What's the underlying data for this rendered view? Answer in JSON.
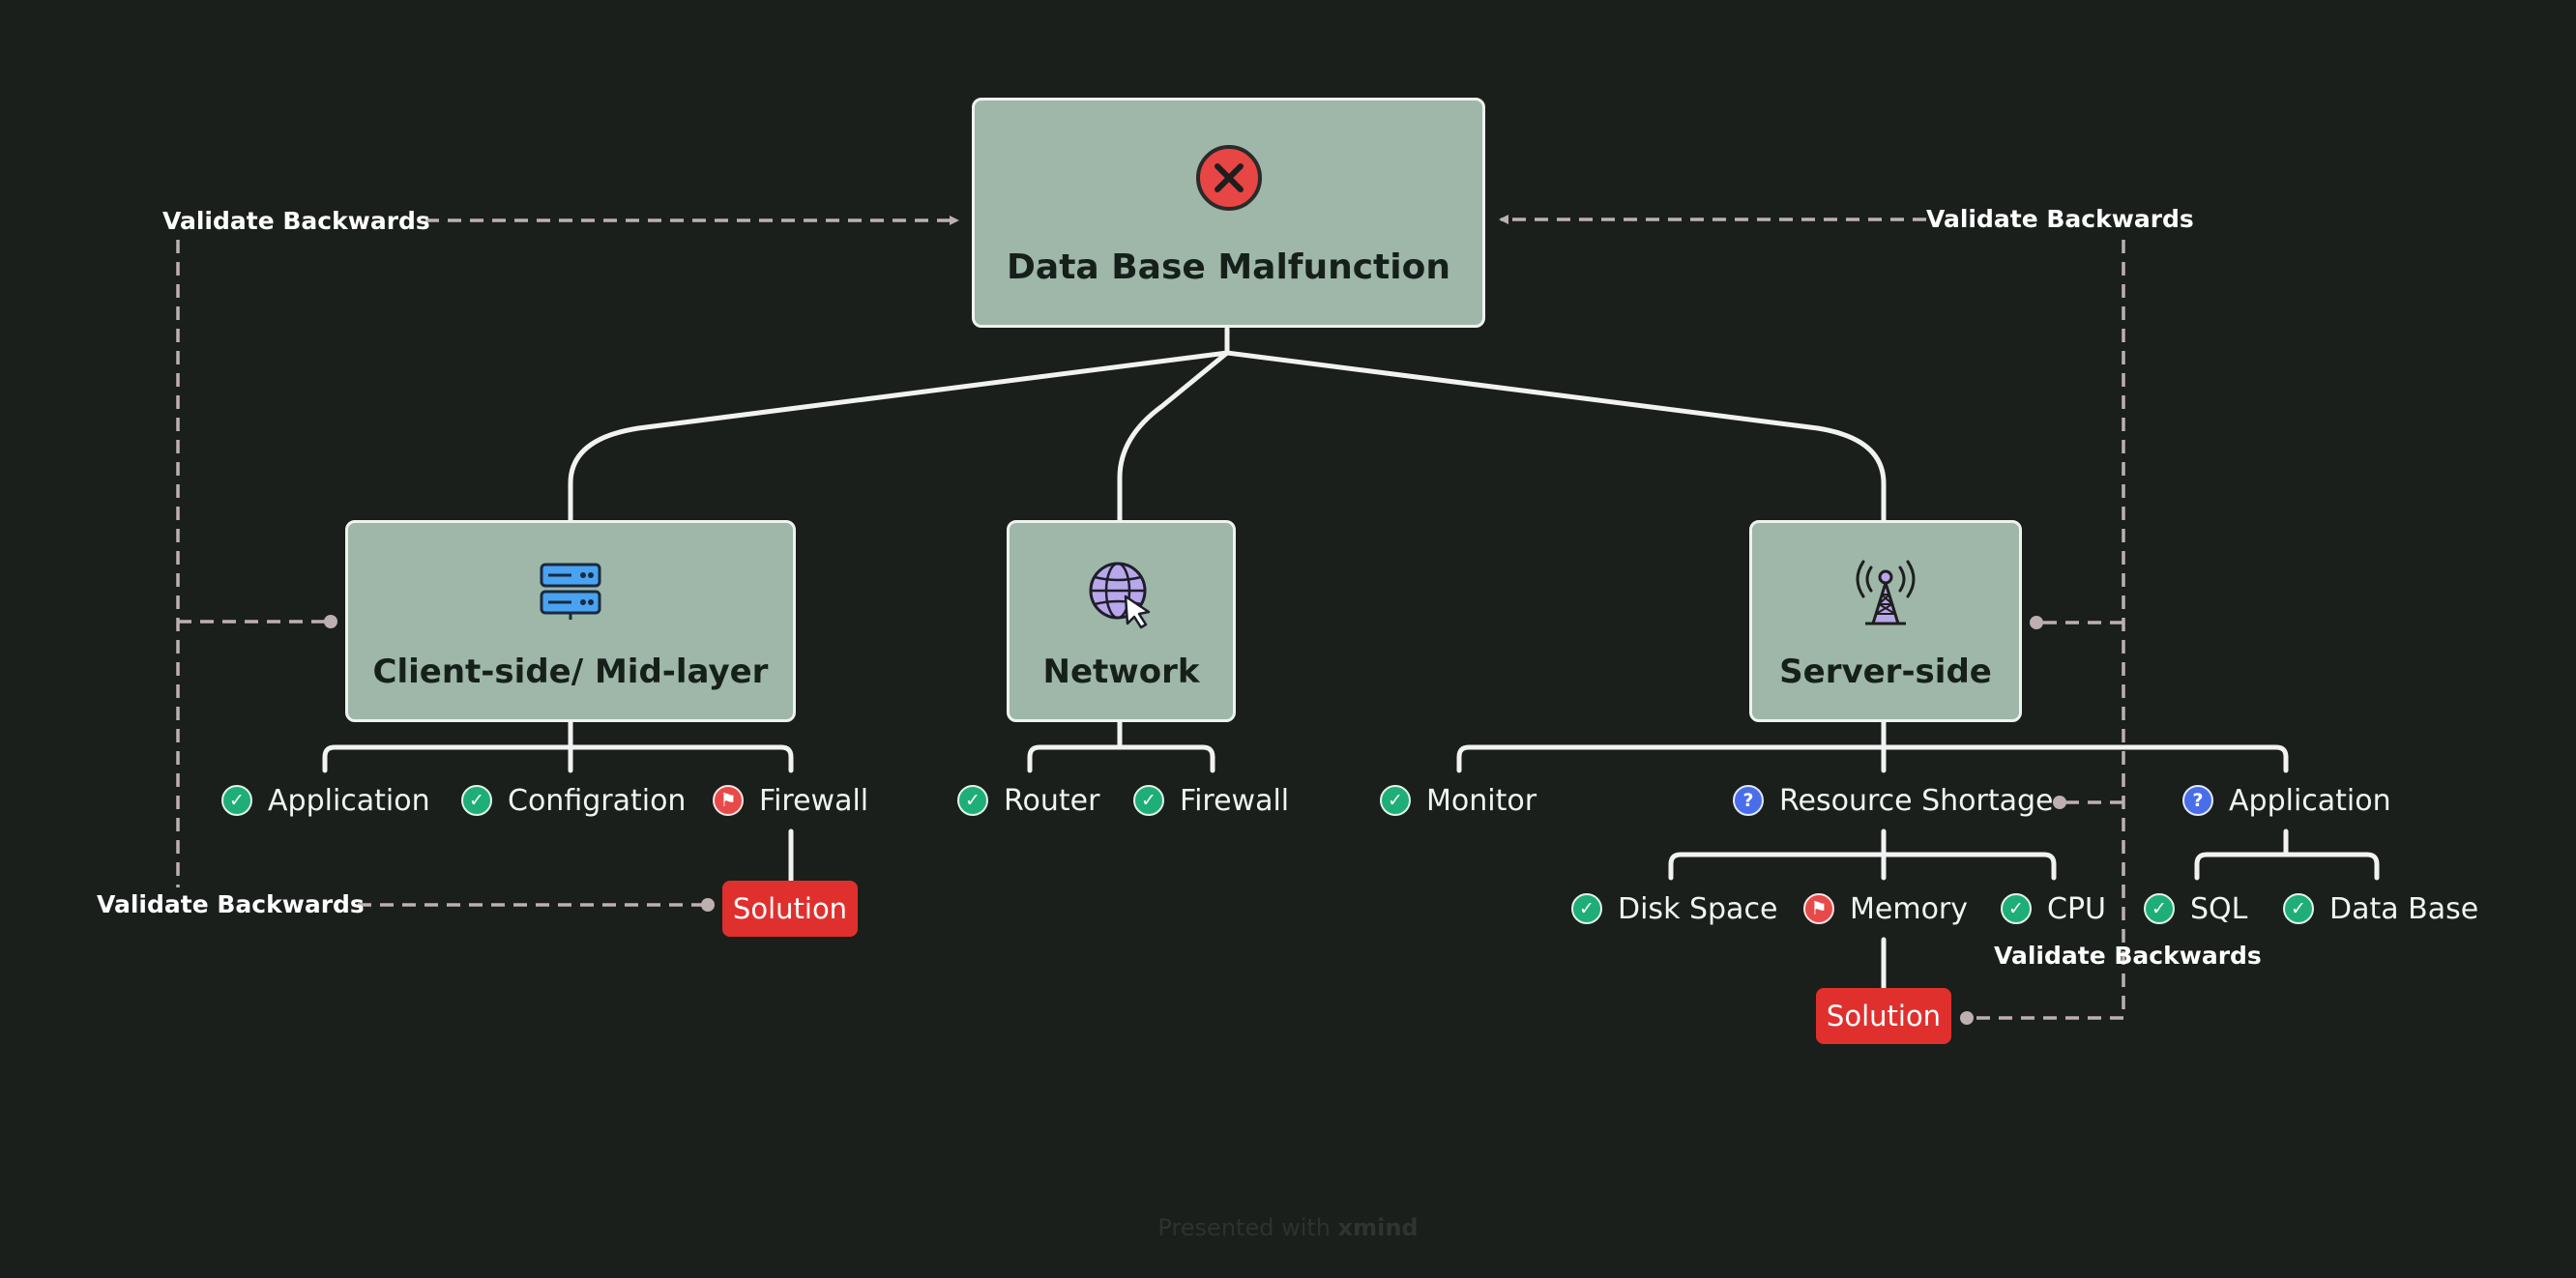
{
  "root": {
    "title": "Data Base Malfunction",
    "icon": "x-circle-icon"
  },
  "branches": {
    "client": {
      "title": "Client-side/ Mid-layer",
      "icon": "server-rack-icon",
      "children": [
        {
          "label": "Application",
          "marker": "check"
        },
        {
          "label": "Configration",
          "marker": "check"
        },
        {
          "label": "Firewall",
          "marker": "flag"
        }
      ],
      "solution": "Solution"
    },
    "network": {
      "title": "Network",
      "icon": "globe-cursor-icon",
      "children": [
        {
          "label": "Router",
          "marker": "check"
        },
        {
          "label": "Firewall",
          "marker": "check"
        }
      ]
    },
    "server": {
      "title": "Server-side",
      "icon": "radio-tower-icon",
      "children": [
        {
          "label": "Monitor",
          "marker": "check"
        },
        {
          "label": "Resource Shortage",
          "marker": "question"
        },
        {
          "label": "Application",
          "marker": "question"
        }
      ],
      "resource_children": [
        {
          "label": "Disk Space",
          "marker": "check"
        },
        {
          "label": "Memory",
          "marker": "flag"
        },
        {
          "label": "CPU",
          "marker": "check"
        }
      ],
      "application_children": [
        {
          "label": "SQL",
          "marker": "check"
        },
        {
          "label": "Data Base",
          "marker": "check"
        }
      ],
      "solution": "Solution"
    }
  },
  "relationships": {
    "top_left": "Validate Backwards",
    "top_right": "Validate Backwards",
    "bottom_left": "Validate Backwards",
    "bottom_right": "Validate Backwards"
  },
  "footer": {
    "prefix": "Presented with",
    "brand": "xmind"
  },
  "colors": {
    "background": "#1a1f1c",
    "node_fill": "#9eb7a8",
    "node_border": "#eef3ef",
    "connector": "#f2f2f2",
    "relationship": "#bdb0b0",
    "solution": "#e0302e",
    "check": "#1fae78",
    "flag": "#e84a4a",
    "question": "#4a6ee8"
  }
}
